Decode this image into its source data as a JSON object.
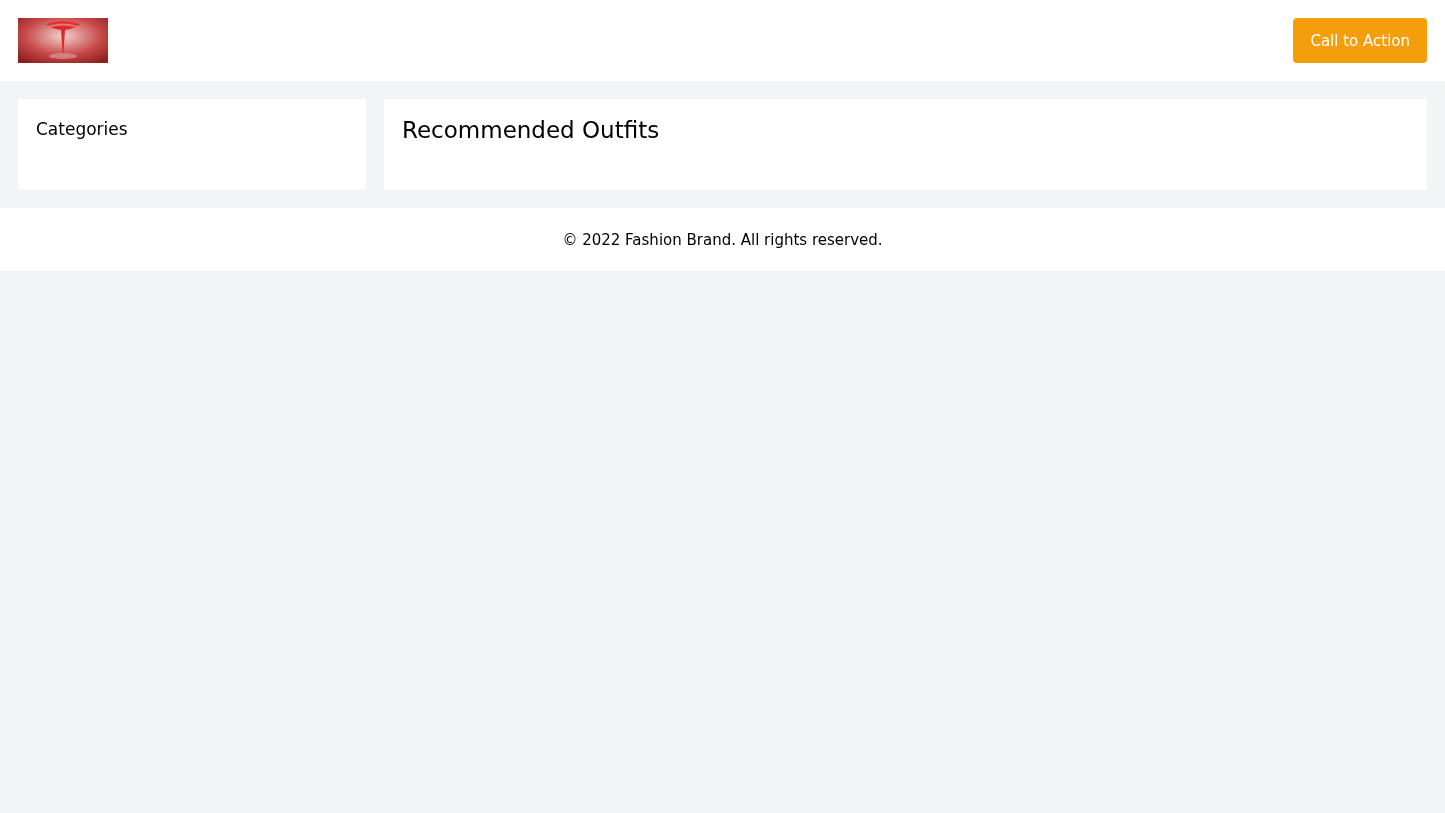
{
  "header": {
    "cta_button": "Call to Action"
  },
  "sidebar": {
    "title": "Categories"
  },
  "content": {
    "title": "Recommended Outfits"
  },
  "footer": "© 2022 Fashion Brand. All rights reserved."
}
